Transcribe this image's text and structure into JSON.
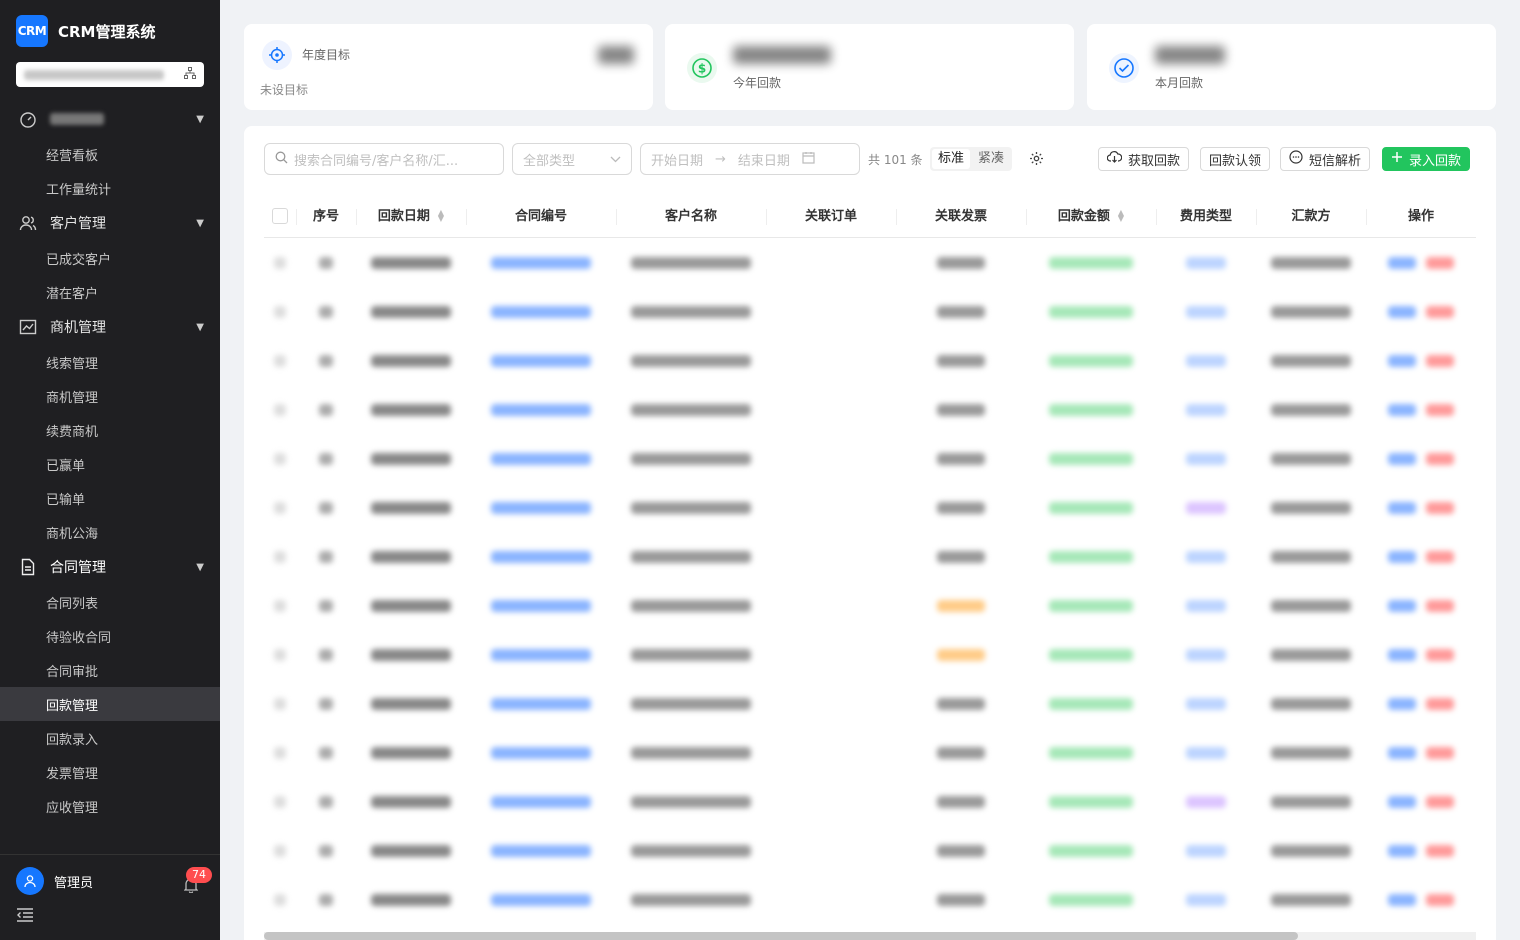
{
  "app": {
    "logo_text": "CRM",
    "title": "CRM管理系统"
  },
  "sidebar": {
    "groups": [
      {
        "label": "",
        "items": [
          {
            "label": "经营看板"
          },
          {
            "label": "工作量统计"
          }
        ]
      },
      {
        "label": "客户管理",
        "items": [
          {
            "label": "已成交客户"
          },
          {
            "label": "潜在客户"
          }
        ]
      },
      {
        "label": "商机管理",
        "items": [
          {
            "label": "线索管理"
          },
          {
            "label": "商机管理"
          },
          {
            "label": "续费商机"
          },
          {
            "label": "已赢单"
          },
          {
            "label": "已输单"
          },
          {
            "label": "商机公海"
          }
        ]
      },
      {
        "label": "合同管理",
        "items": [
          {
            "label": "合同列表"
          },
          {
            "label": "待验收合同"
          },
          {
            "label": "合同审批"
          },
          {
            "label": "回款管理"
          },
          {
            "label": "回款录入"
          },
          {
            "label": "发票管理"
          },
          {
            "label": "应收管理"
          }
        ]
      }
    ],
    "active_item": "回款管理",
    "user_name": "管理员",
    "notification_count": "74"
  },
  "stats": {
    "card1": {
      "title": "年度目标",
      "subtitle": "未设目标"
    },
    "card2": {
      "label": "今年回款"
    },
    "card3": {
      "label": "本月回款"
    }
  },
  "toolbar": {
    "search_placeholder": "搜索合同编号/客户名称/汇...",
    "type_placeholder": "全部类型",
    "start_date_placeholder": "开始日期",
    "end_date_placeholder": "结束日期",
    "total_text": "共 101 条",
    "density_standard": "标准",
    "density_compact": "紧凑",
    "btn_fetch": "获取回款",
    "btn_claim": "回款认领",
    "btn_sms": "短信解析",
    "btn_add": "录入回款"
  },
  "table": {
    "columns": [
      "序号",
      "回款日期",
      "合同编号",
      "客户名称",
      "关联订单",
      "关联发票",
      "回款金额",
      "费用类型",
      "汇款方",
      "操作"
    ]
  },
  "colors": {
    "accent": "#1677ff",
    "success": "#22c55e",
    "sidebar_bg": "#1f1f22",
    "danger": "#ff4d4f"
  }
}
